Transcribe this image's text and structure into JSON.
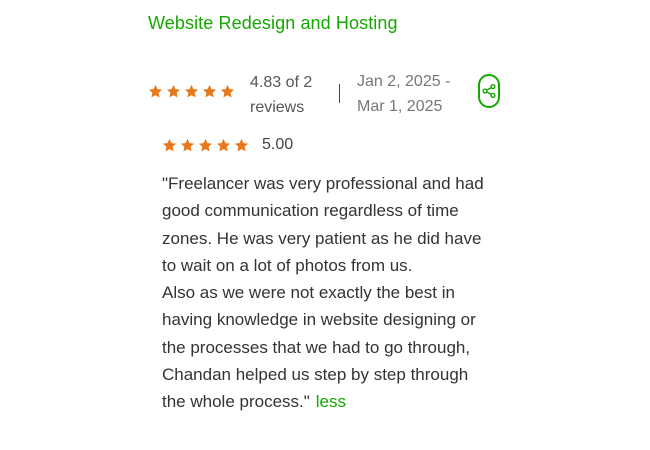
{
  "review": {
    "title": "Website Redesign and Hosting",
    "summary": {
      "rating_value": 4.83,
      "stars_filled": 5,
      "score_text": "4.83 of 2 reviews",
      "date_range": "Jan 2, 2025 - Mar 1, 2025",
      "share_icon": "share-icon"
    },
    "client_feedback": {
      "rating_value": 5.0,
      "stars_filled": 5,
      "score_text": "5.00",
      "paragraph_1": "\"Freelancer was very professional and had good communication regardless of time zones. He was very patient as he did have to wait on a lot of photos from us.",
      "paragraph_2": "Also as we were not exactly the best in having knowledge in website designing or the processes that we had to go through, Chandan helped us step by step through the whole process.\"",
      "less_label": "less"
    }
  },
  "colors": {
    "accent": "#14a800",
    "star": "#e6781e",
    "text": "#333333",
    "muted": "#777777"
  }
}
